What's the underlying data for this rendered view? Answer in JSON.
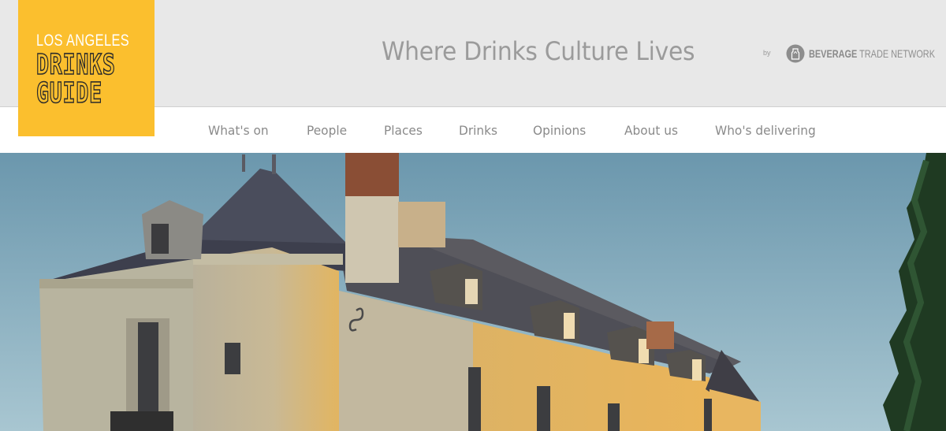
{
  "logo": {
    "line1": "LOS ANGELES",
    "line2": "DRINKS",
    "line3": "GUIDE",
    "bg_color": "#fbbf2e"
  },
  "header": {
    "tagline": "Where Drinks Culture Lives",
    "by": "by",
    "partner_bold": "BEVERAGE",
    "partner_rest": " TRADE NETWORK",
    "partner_icon": "beverage-trade-network-logo-icon"
  },
  "nav": {
    "items": [
      "What's on",
      "People",
      "Places",
      "Drinks",
      "Opinions",
      "About us",
      "Who's delivering"
    ]
  },
  "hero": {
    "image": "chateau-photo"
  }
}
